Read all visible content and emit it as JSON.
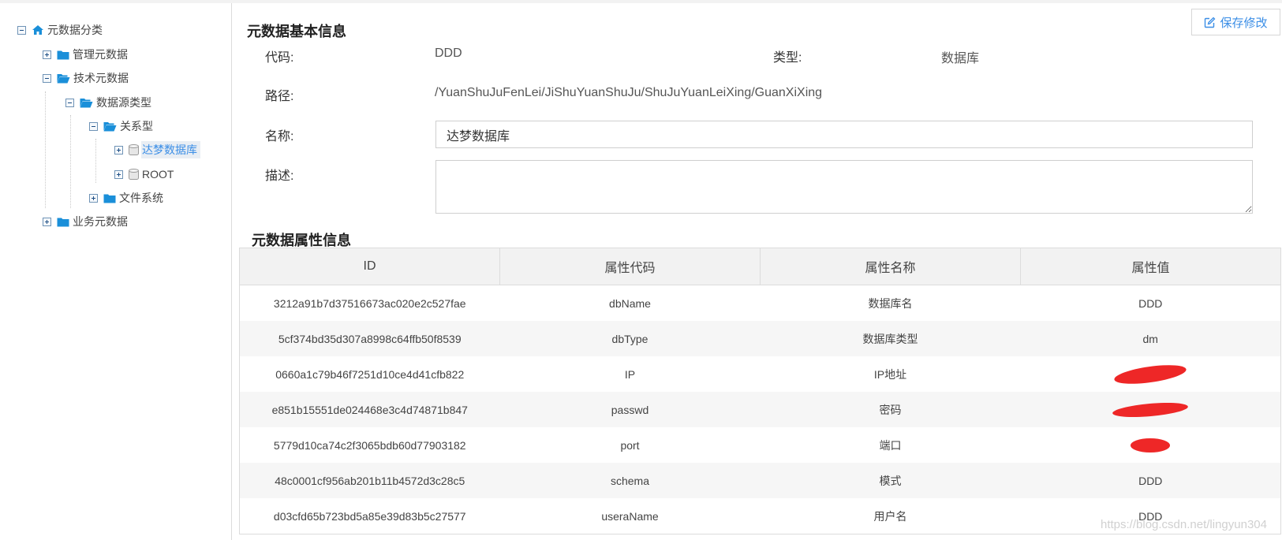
{
  "tree": {
    "root": "元数据分类",
    "items": [
      {
        "label": "管理元数据",
        "expanded": false
      },
      {
        "label": "技术元数据",
        "expanded": true
      },
      {
        "label": "数据源类型",
        "expanded": true
      },
      {
        "label": "关系型",
        "expanded": true
      },
      {
        "label": "达梦数据库",
        "expanded": false,
        "selected": true
      },
      {
        "label": "ROOT",
        "expanded": false
      },
      {
        "label": "文件系统",
        "expanded": false
      },
      {
        "label": "业务元数据",
        "expanded": false
      }
    ]
  },
  "basic": {
    "title": "元数据基本信息",
    "save_label": "保存修改",
    "code_label": "代码:",
    "code_value": "DDD",
    "type_label": "类型:",
    "type_value": "数据库",
    "path_label": "路径:",
    "path_value": "/YuanShuJuFenLei/JiShuYuanShuJu/ShuJuYuanLeiXing/GuanXiXing",
    "name_label": "名称:",
    "name_value": "达梦数据库",
    "desc_label": "描述:",
    "desc_value": ""
  },
  "attributes": {
    "title": "元数据属性信息",
    "columns": [
      "ID",
      "属性代码",
      "属性名称",
      "属性值"
    ],
    "rows": [
      {
        "id": "3212a91b7d37516673ac020e2c527fae",
        "code": "dbName",
        "name": "数据库名",
        "value": "DDD"
      },
      {
        "id": "5cf374bd35d307a8998c64ffb50f8539",
        "code": "dbType",
        "name": "数据库类型",
        "value": "dm"
      },
      {
        "id": "0660a1c79b46f7251d10ce4d41cfb822",
        "code": "IP",
        "name": "IP地址",
        "value": ""
      },
      {
        "id": "e851b15551de024468e3c4d74871b847",
        "code": "passwd",
        "name": "密码",
        "value": ""
      },
      {
        "id": "5779d10ca74c2f3065bdb60d77903182",
        "code": "port",
        "name": "端口",
        "value": ""
      },
      {
        "id": "48c0001cf956ab201b11b4572d3c28c5",
        "code": "schema",
        "name": "模式",
        "value": "DDD"
      },
      {
        "id": "d03cfd65b723bd5a85e39d83b5c27577",
        "code": "useraName",
        "name": "用户名",
        "value": "DDD"
      }
    ]
  },
  "watermark": "https://blog.csdn.net/lingyun304",
  "colors": {
    "accent": "#3b8ee6",
    "folder": "#1a8fd9",
    "redaction": "#ee2727"
  }
}
